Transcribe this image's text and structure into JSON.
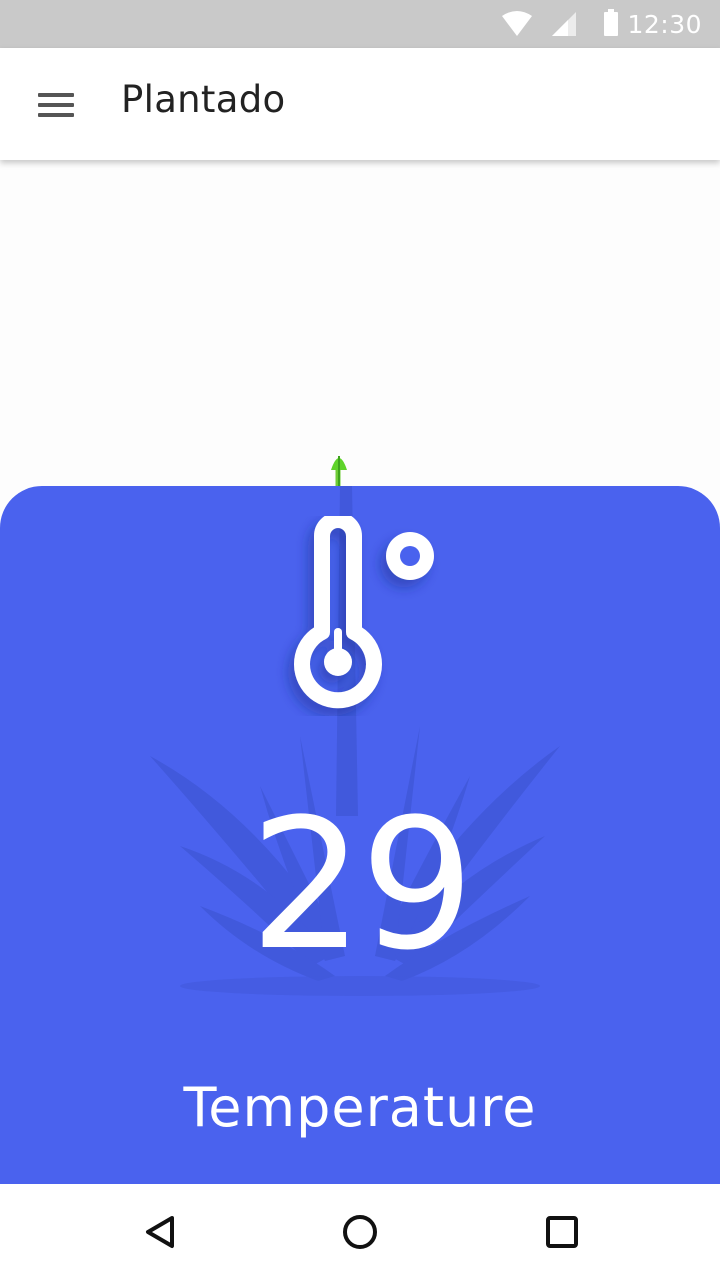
{
  "status_bar": {
    "time": "12:30",
    "icons": [
      "wifi-icon",
      "cell-signal-icon",
      "battery-icon"
    ],
    "background": "#c9c9c9"
  },
  "app_bar": {
    "title": "Plantado",
    "menu_icon": "hamburger-menu-icon"
  },
  "sensor": {
    "icon": "thermometer-degree-icon",
    "value": "29",
    "label": "Temperature",
    "card_color": "#4a62ee",
    "accent_sprout_color": "#5fd32a"
  },
  "nav_bar": {
    "buttons": [
      "back-icon",
      "home-icon",
      "recents-icon"
    ]
  }
}
